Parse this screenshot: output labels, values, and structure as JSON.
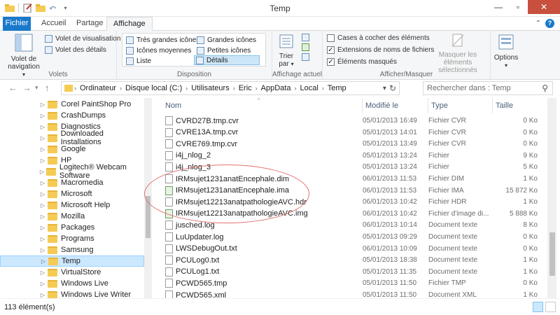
{
  "window": {
    "title": "Temp"
  },
  "tabs": [
    "Fichier",
    "Accueil",
    "Partage",
    "Affichage"
  ],
  "ribbon": {
    "volets": {
      "group_label": "Volets",
      "nav_pane": "Volet de navigation",
      "preview_pane": "Volet de visualisation",
      "details_pane": "Volet des détails"
    },
    "disposition": {
      "group_label": "Disposition",
      "items": [
        "Très grandes icônes",
        "Grandes icônes",
        "Icônes moyennes",
        "Petites icônes",
        "Liste",
        "Détails"
      ],
      "selected": "Détails"
    },
    "affichage_actuel": {
      "group_label": "Affichage actuel",
      "sort": "Trier par"
    },
    "afficher_masquer": {
      "group_label": "Afficher/Masquer",
      "checkboxes": [
        {
          "label": "Cases à cocher des éléments",
          "checked": false
        },
        {
          "label": "Extensions de noms de fichiers",
          "checked": true
        },
        {
          "label": "Éléments masqués",
          "checked": true
        }
      ],
      "hide_selected": "Masquer les éléments sélectionnés"
    },
    "options": "Options"
  },
  "address": {
    "crumbs": [
      "Ordinateur",
      "Disque local (C:)",
      "Utilisateurs",
      "Eric",
      "AppData",
      "Local",
      "Temp"
    ],
    "search_placeholder": "Rechercher dans : Temp"
  },
  "tree": {
    "items": [
      {
        "label": "Corel PaintShop Pro"
      },
      {
        "label": "CrashDumps"
      },
      {
        "label": "Diagnostics"
      },
      {
        "label": "Downloaded Installations"
      },
      {
        "label": "Google"
      },
      {
        "label": "HP"
      },
      {
        "label": "Logitech® Webcam Software"
      },
      {
        "label": "Macromedia"
      },
      {
        "label": "Microsoft"
      },
      {
        "label": "Microsoft Help"
      },
      {
        "label": "Mozilla"
      },
      {
        "label": "Packages"
      },
      {
        "label": "Programs"
      },
      {
        "label": "Samsung"
      },
      {
        "label": "Temp"
      },
      {
        "label": "VirtualStore"
      },
      {
        "label": "Windows Live"
      },
      {
        "label": "Windows Live Writer"
      }
    ],
    "selected": "Temp"
  },
  "columns": [
    "Nom",
    "Modifié le",
    "Type",
    "Taille"
  ],
  "files": [
    {
      "name": "CVRD27B.tmp.cvr",
      "date": "05/01/2013 16:49",
      "type": "Fichier CVR",
      "size": "0 Ko"
    },
    {
      "name": "CVRE13A.tmp.cvr",
      "date": "05/01/2013 14:01",
      "type": "Fichier CVR",
      "size": "0 Ko"
    },
    {
      "name": "CVRE769.tmp.cvr",
      "date": "05/01/2013 13:49",
      "type": "Fichier CVR",
      "size": "0 Ko"
    },
    {
      "name": "i4j_nlog_2",
      "date": "05/01/2013 13:24",
      "type": "Fichier",
      "size": "9 Ko"
    },
    {
      "name": "i4j_nlog_3",
      "date": "05/01/2013 13:24",
      "type": "Fichier",
      "size": "5 Ko"
    },
    {
      "name": "IRMsujet1231anatEncephale.dim",
      "date": "06/01/2013 11:53",
      "type": "Fichier DIM",
      "size": "1 Ko"
    },
    {
      "name": "IRMsujet1231anatEncephale.ima",
      "date": "06/01/2013 11:53",
      "type": "Fichier IMA",
      "size": "15 872 Ko"
    },
    {
      "name": "IRMsujet12213anatpathologieAVC.hdr",
      "date": "06/01/2013 10:42",
      "type": "Fichier HDR",
      "size": "1 Ko"
    },
    {
      "name": "IRMsujet12213anatpathologieAVC.img",
      "date": "06/01/2013 10:42",
      "type": "Fichier d'image di...",
      "size": "5 888 Ko"
    },
    {
      "name": "jusched.log",
      "date": "06/01/2013 10:14",
      "type": "Document texte",
      "size": "8 Ko"
    },
    {
      "name": "LuUpdater.log",
      "date": "05/01/2013 09:29",
      "type": "Document texte",
      "size": "0 Ko"
    },
    {
      "name": "LWSDebugOut.txt",
      "date": "06/01/2013 10:09",
      "type": "Document texte",
      "size": "0 Ko"
    },
    {
      "name": "PCULog0.txt",
      "date": "05/01/2013 18:38",
      "type": "Document texte",
      "size": "1 Ko"
    },
    {
      "name": "PCULog1.txt",
      "date": "05/01/2013 11:35",
      "type": "Document texte",
      "size": "1 Ko"
    },
    {
      "name": "PCWD565.tmp",
      "date": "05/01/2013 11:50",
      "type": "Fichier TMP",
      "size": "0 Ko"
    },
    {
      "name": "PCWD565.xml",
      "date": "05/01/2013 11:50",
      "type": "Document XML",
      "size": "1 Ko"
    }
  ],
  "status": {
    "count": "113 élément(s)"
  }
}
